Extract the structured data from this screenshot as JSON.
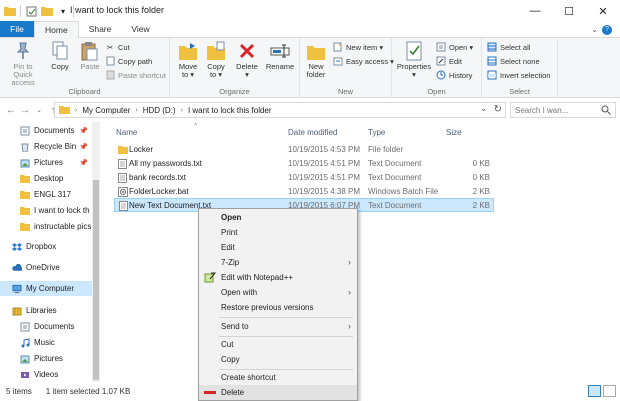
{
  "window": {
    "title": "I want to lock this folder",
    "minimize": "—",
    "maximize": "☐",
    "close": "✕",
    "qat_dropdown": "▾"
  },
  "ribbon_tabs": [
    "File",
    "Home",
    "Share",
    "View"
  ],
  "ribbon": {
    "clipboard": {
      "label": "Clipboard",
      "pin_line1": "Pin to Quick",
      "pin_line2": "access",
      "copy": "Copy",
      "paste": "Paste",
      "cut": "Cut",
      "copy_path": "Copy path",
      "paste_shortcut": "Paste shortcut"
    },
    "organize": {
      "label": "Organize",
      "move_line1": "Move",
      "move_line2": "to ▾",
      "copy_line1": "Copy",
      "copy_line2": "to ▾",
      "delete_line1": "Delete",
      "delete_line2": "▾",
      "rename": "Rename"
    },
    "new": {
      "label": "New",
      "new_folder_line1": "New",
      "new_folder_line2": "folder",
      "new_item": "New item ▾",
      "easy_access": "Easy access ▾"
    },
    "open": {
      "label": "Open",
      "properties_line1": "Properties",
      "properties_line2": "▾",
      "open": "Open ▾",
      "edit": "Edit",
      "history": "History"
    },
    "select": {
      "label": "Select",
      "select_all": "Select all",
      "select_none": "Select none",
      "invert_selection": "Invert selection"
    }
  },
  "address": {
    "crumbs": [
      "My Computer",
      "HDD (D:)",
      "I want to lock this folder"
    ],
    "search_placeholder": "Search I wan..."
  },
  "nav_pane": [
    {
      "label": "Documents",
      "icon": "documents-icon",
      "pinned": true
    },
    {
      "label": "Recycle Bin",
      "icon": "recycle-bin-icon",
      "pinned": true
    },
    {
      "label": "Pictures",
      "icon": "pictures-icon",
      "pinned": true
    },
    {
      "label": "Desktop",
      "icon": "folder-icon",
      "pinned": false
    },
    {
      "label": "ENGL 317",
      "icon": "folder-icon",
      "pinned": false
    },
    {
      "label": "I want to lock th",
      "icon": "folder-icon",
      "pinned": false
    },
    {
      "label": "instructable pics",
      "icon": "folder-icon",
      "pinned": false
    },
    {
      "label": "Dropbox",
      "icon": "dropbox-icon",
      "pinned": false
    },
    {
      "label": "OneDrive",
      "icon": "onedrive-icon",
      "pinned": false
    },
    {
      "label": "My Computer",
      "icon": "computer-icon",
      "pinned": false,
      "selected": true
    },
    {
      "label": "Libraries",
      "icon": "libraries-icon",
      "pinned": false
    },
    {
      "label": "Documents",
      "icon": "documents-icon",
      "pinned": false
    },
    {
      "label": "Music",
      "icon": "music-icon",
      "pinned": false
    },
    {
      "label": "Pictures",
      "icon": "pictures-icon",
      "pinned": false
    },
    {
      "label": "Videos",
      "icon": "videos-icon",
      "pinned": false
    }
  ],
  "columns": {
    "name": "Name",
    "date": "Date modified",
    "type": "Type",
    "size": "Size",
    "sort_indicator": "^"
  },
  "files": [
    {
      "name": "Locker",
      "date": "10/19/2015 4:53 PM",
      "type": "File folder",
      "size": "",
      "icon": "folder-icon"
    },
    {
      "name": "All my passwords.txt",
      "date": "10/19/2015 4:51 PM",
      "type": "Text Document",
      "size": "0 KB",
      "icon": "text-file-icon"
    },
    {
      "name": "bank records.txt",
      "date": "10/19/2015 4:51 PM",
      "type": "Text Document",
      "size": "0 KB",
      "icon": "text-file-icon"
    },
    {
      "name": "FolderLocker.bat",
      "date": "10/19/2015 4:38 PM",
      "type": "Windows Batch File",
      "size": "2 KB",
      "icon": "batch-file-icon"
    },
    {
      "name": "New Text Document.txt",
      "date": "10/19/2015 6:07 PM",
      "type": "Text Document",
      "size": "2 KB",
      "icon": "text-file-icon",
      "selected": true
    }
  ],
  "status": {
    "items": "5 items",
    "selected": "1 item selected  1.07 KB"
  },
  "context_menu": [
    {
      "label": "Open",
      "bold": true
    },
    {
      "label": "Print"
    },
    {
      "label": "Edit"
    },
    {
      "label": "7-Zip",
      "submenu": true
    },
    {
      "label": "Edit with Notepad++",
      "icon": "notepadpp-icon"
    },
    {
      "label": "Open with",
      "submenu": true
    },
    {
      "label": "Restore previous versions"
    },
    {
      "separator": true
    },
    {
      "label": "Send to",
      "submenu": true
    },
    {
      "separator": true
    },
    {
      "label": "Cut"
    },
    {
      "label": "Copy"
    },
    {
      "separator": true
    },
    {
      "label": "Create shortcut"
    },
    {
      "label": "Delete",
      "icon": "delete-icon",
      "hover": true
    }
  ],
  "colors": {
    "accent": "#1979ca",
    "selection": "#cce8ff",
    "folder": "#f0c040",
    "delete_red": "#d92525"
  }
}
